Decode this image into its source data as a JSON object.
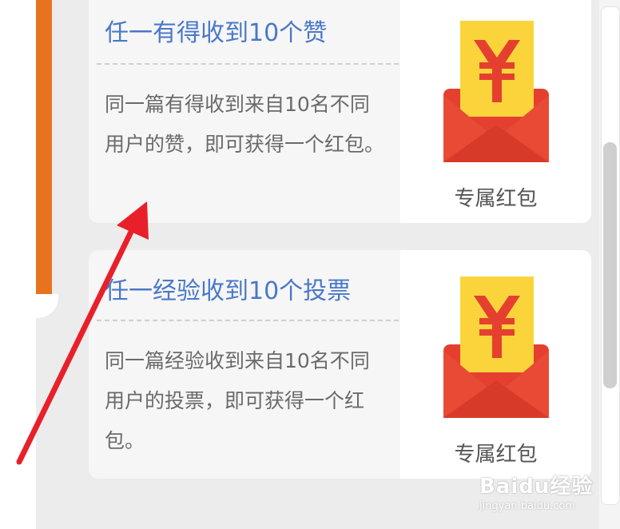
{
  "cards": [
    {
      "title": "任一有得收到10个赞",
      "description": "同一篇有得收到来自10名不同用户的赞，即可获得一个红包。",
      "reward_icon": "red-envelope-yuan-icon",
      "reward_label": "专属红包"
    },
    {
      "title": "任一经验收到10个投票",
      "description": "同一篇经验收到来自10名不同用户的投票，即可获得一个红包。",
      "reward_icon": "red-envelope-yuan-icon",
      "reward_label": "专属红包"
    }
  ],
  "annotation": {
    "type": "red-arrow",
    "color": "#e8202a"
  },
  "watermark": {
    "brand": "Baidu经验",
    "url": "jingyan.baidu.com"
  },
  "colors": {
    "accent_strip": "#e8731f",
    "title": "#4a78c8",
    "envelope_red": "#e5402f",
    "envelope_yellow": "#fbd43c"
  }
}
